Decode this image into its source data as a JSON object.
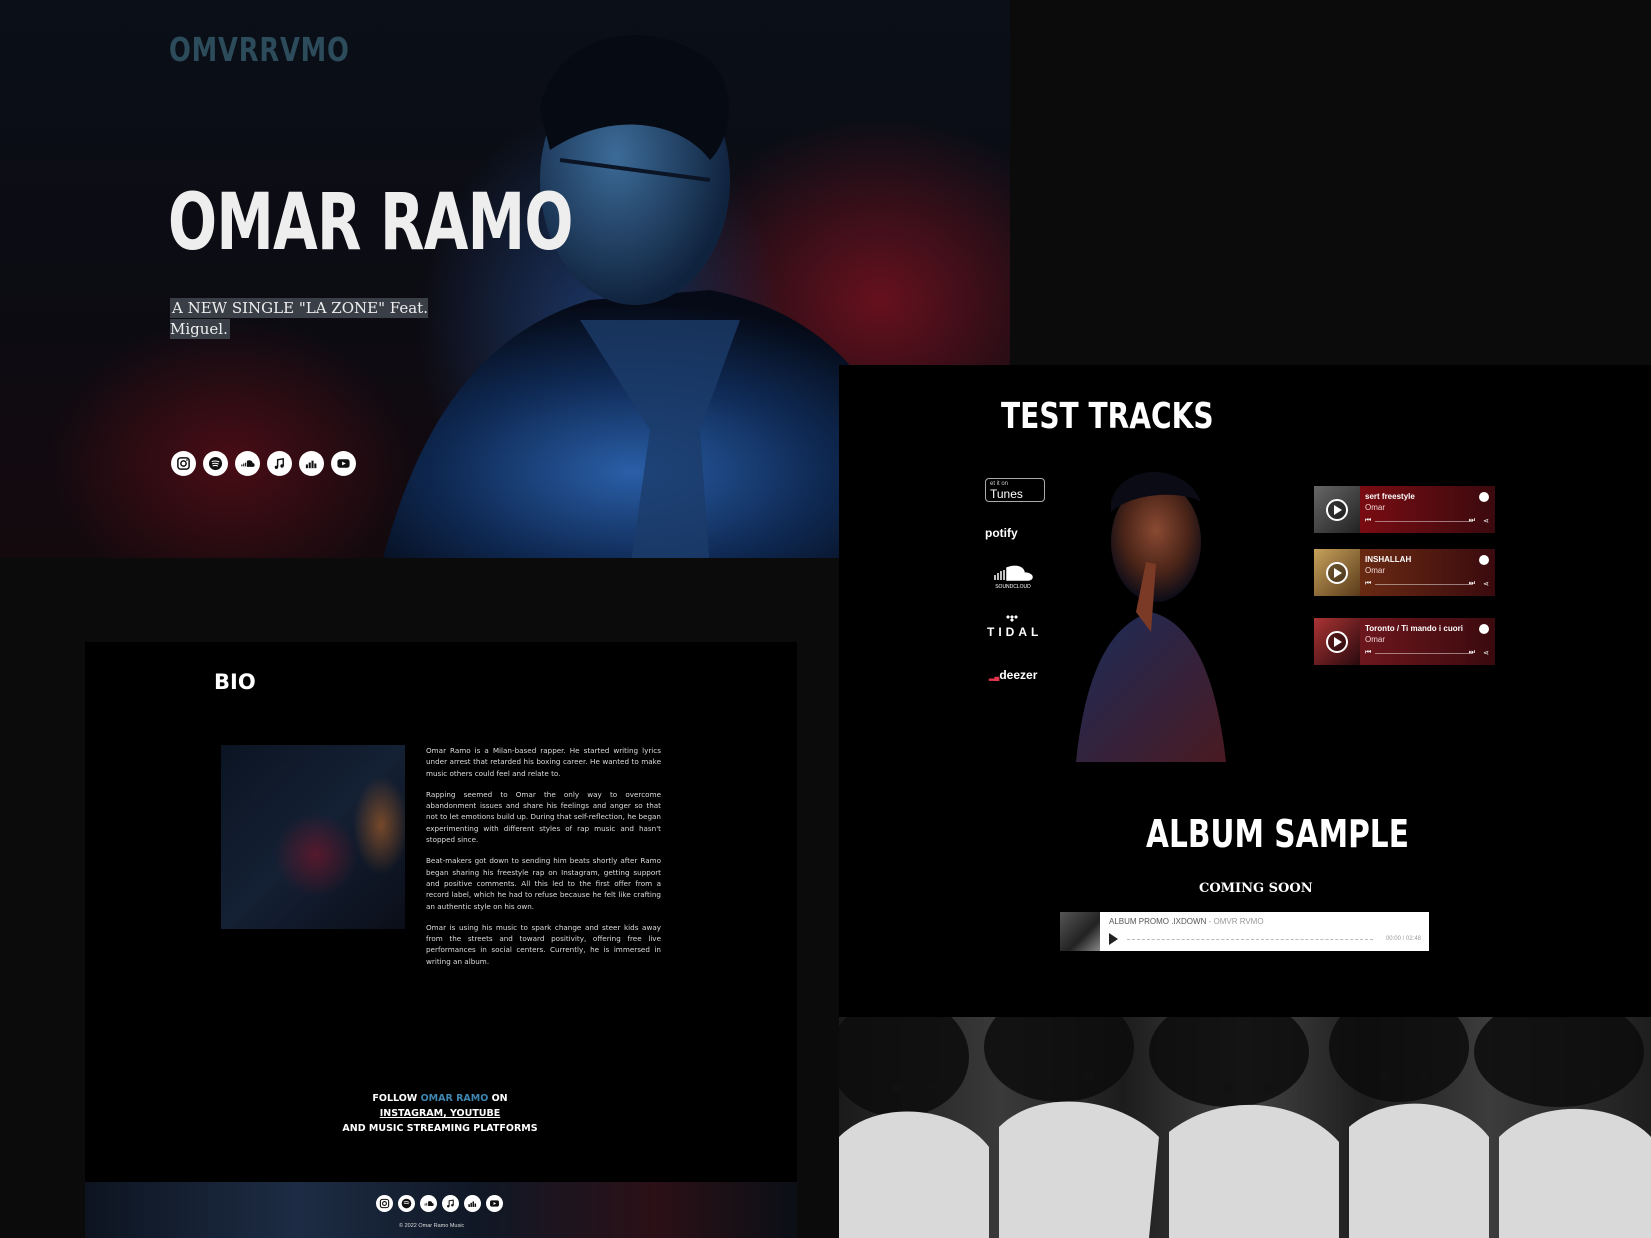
{
  "hero": {
    "logo": "OMVRRVMO",
    "title": "OMAR RAMO",
    "subtitle": "A NEW SINGLE  \"LA ZONE\" Feat. Miguel.",
    "social_icons": [
      "instagram-icon",
      "spotify-icon",
      "soundcloud-icon",
      "apple-music-icon",
      "deezer-icon",
      "youtube-icon"
    ]
  },
  "tracks_section": {
    "title": "TEST TRACKS",
    "platforms": {
      "itunes_small": "et it on",
      "itunes": "Tunes",
      "spotify": "potify",
      "soundcloud": "SOUNDCLOUD",
      "tidal": "TIDAL",
      "deezer": "deezer"
    },
    "tracks": [
      {
        "title": "sert freestyle",
        "artist": "Omar",
        "color": "#8e0d14"
      },
      {
        "title": "INSHALLAH",
        "artist": "Omar",
        "color": "#7a3514"
      },
      {
        "title": "Toronto / Ti mando i cuori",
        "artist": "Omar",
        "color": "#7e1b22"
      }
    ]
  },
  "album": {
    "title": "ALBUM SAMPLE",
    "status": "COMING SOON",
    "player": {
      "track": "ALBUM PROMO .IXDOWN",
      "separator": "-",
      "artist": "OMVR RVMO",
      "time": "00:00 / 02:48"
    }
  },
  "bio": {
    "title": "BIO",
    "paragraphs": [
      "Omar Ramo is a Milan-based rapper. He started writing lyrics under arrest that retarded his boxing career. He wanted to make music others could feel and relate to.",
      "Rapping seemed to Omar the only way to overcome abandonment issues and share his feelings and anger so that not to let emotions build up. During that self-reflection, he began experimenting with different styles of rap music and hasn't stopped since.",
      "Beat-makers got down to sending him beats shortly after Ramo began sharing his freestyle rap on Instagram, getting support and positive comments. All this led to the first offer from a record label, which he had to refuse because he felt like crafting an authentic style on his own.",
      "Omar is using his music to spark change and steer kids away from the streets and toward positivity, offering free live performances in social centers. Currently, he is immersed in writing an album."
    ],
    "follow": {
      "prefix": "FOLLOW ",
      "name": "OMAR RAMO",
      "suffix": " ON",
      "links": "INSTAGRAM, YOUTUBE ",
      "line3": "AND MUSIC STREAMING PLATFORMS"
    },
    "copyright": "© 2022 Omar Ramo Music"
  }
}
